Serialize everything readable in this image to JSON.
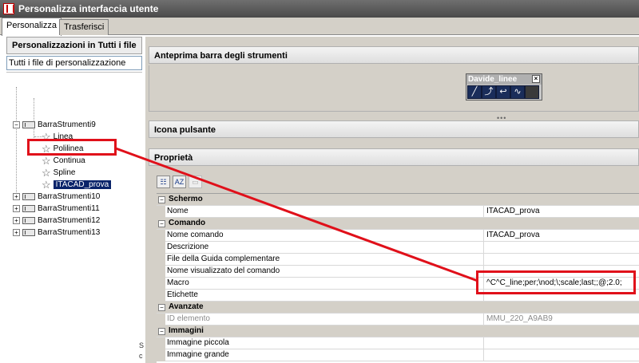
{
  "window": {
    "title": "Personalizza interfaccia utente"
  },
  "tabs": [
    {
      "label": "Personalizza"
    },
    {
      "label": "Trasferisci"
    }
  ],
  "left": {
    "header": "Personalizzazioni in Tutti i file",
    "filter_value": "Tutti i file di personalizzazione",
    "tree": {
      "parent": "BarraStrumenti9",
      "children": [
        "Linea",
        "Polilinea",
        "Continua",
        "Spline",
        "ITACAD_prova"
      ],
      "siblings": [
        "BarraStrumenti10",
        "BarraStrumenti11",
        "BarraStrumenti12",
        "BarraStrumenti13"
      ]
    }
  },
  "right": {
    "preview_header": "Anteprima barra degli strumenti",
    "toolbar_preview_title": "Davide_linee",
    "icon_header": "Icona pulsante",
    "properties_header": "Proprietà",
    "properties": {
      "screen": {
        "category": "Schermo",
        "rows": [
          {
            "name": "Nome",
            "value": "ITACAD_prova"
          }
        ]
      },
      "command": {
        "category": "Comando",
        "rows": [
          {
            "name": "Nome comando",
            "value": "ITACAD_prova"
          },
          {
            "name": "Descrizione",
            "value": ""
          },
          {
            "name": "File della Guida complementare",
            "value": ""
          },
          {
            "name": "Nome visualizzato del comando",
            "value": ""
          },
          {
            "name": "Macro",
            "value": "^C^C_line;per;\\nod;\\;scale;last;;@;2.0;"
          },
          {
            "name": "Etichette",
            "value": ""
          }
        ]
      },
      "advanced": {
        "category": "Avanzate",
        "rows": [
          {
            "name": "ID elemento",
            "value": "MMU_220_A9AB9"
          }
        ]
      },
      "images": {
        "category": "Immagini",
        "rows": [
          {
            "name": "Immagine piccola",
            "value": ""
          },
          {
            "name": "Immagine grande",
            "value": ""
          }
        ]
      }
    }
  },
  "stray_marks": [
    "S",
    "c"
  ],
  "colors": {
    "callout": "#e0101a",
    "selection": "#0a246a"
  }
}
